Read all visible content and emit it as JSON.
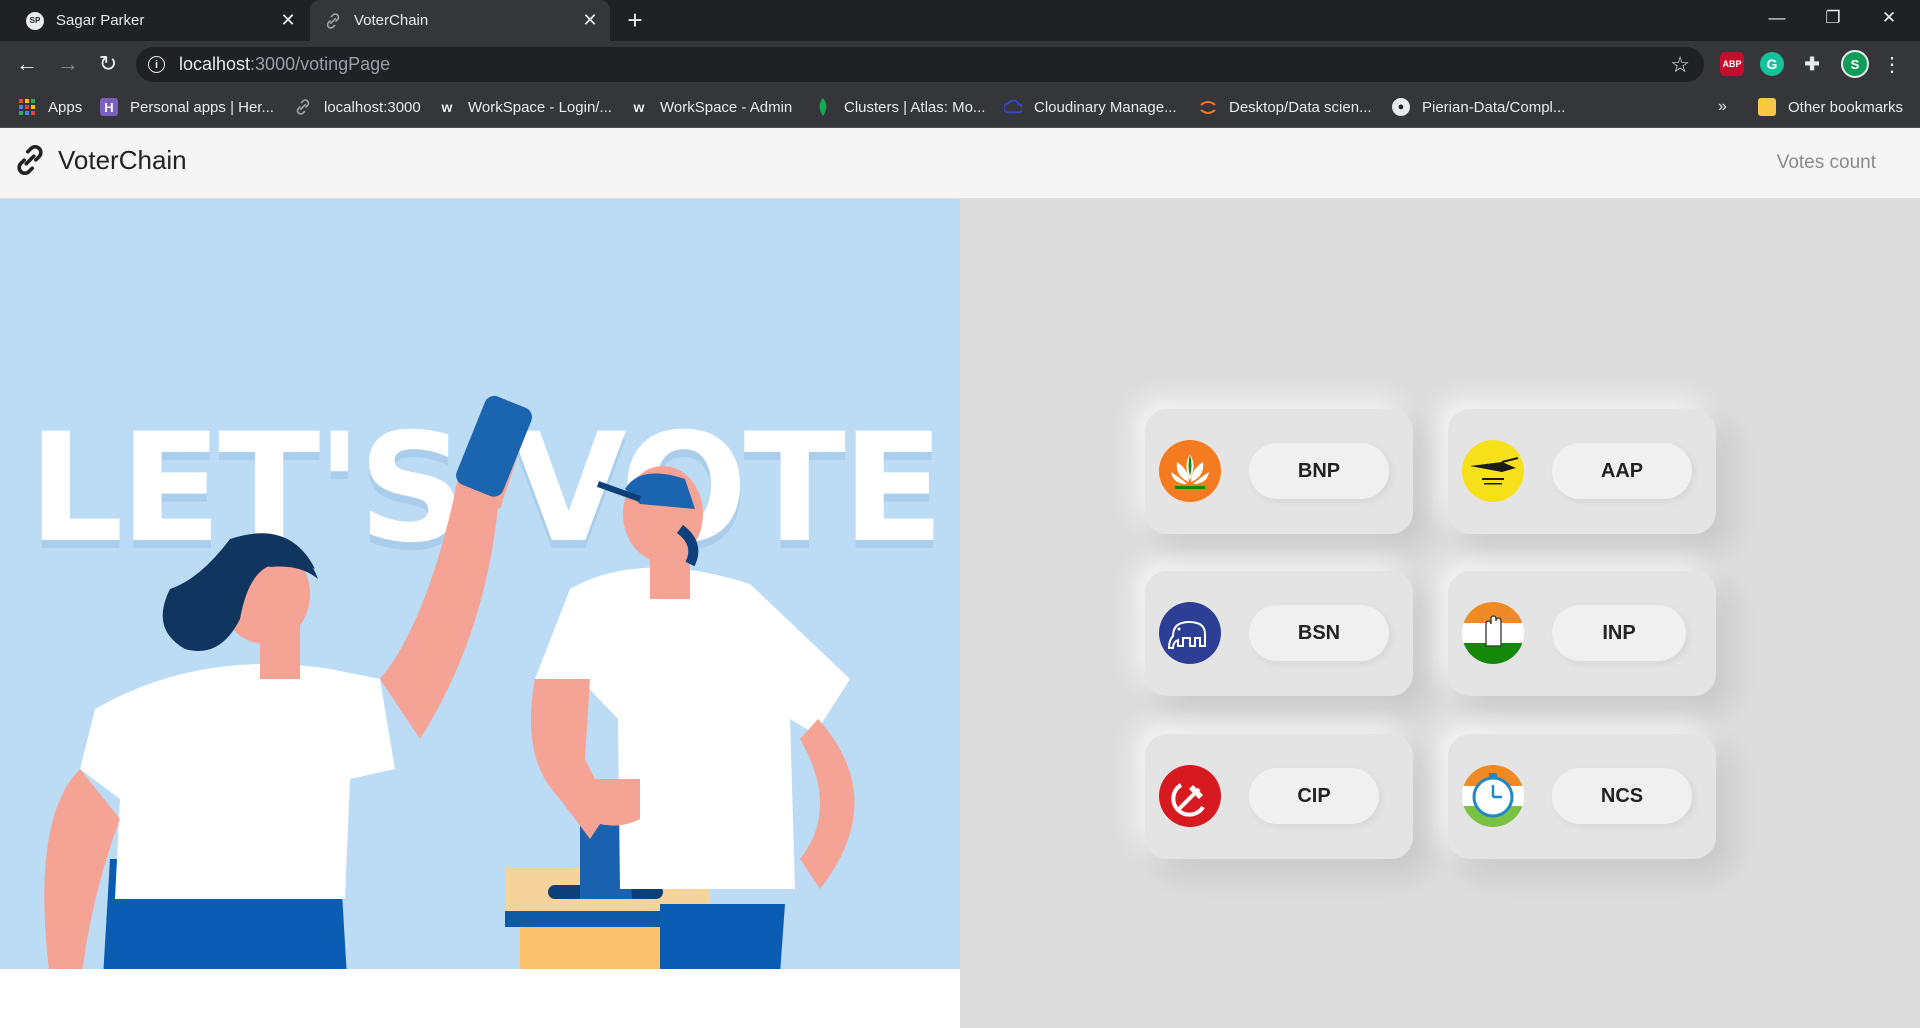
{
  "browser": {
    "tabs": [
      {
        "title": "Sagar Parker",
        "icon": "sp-favicon",
        "active": false
      },
      {
        "title": "VoterChain",
        "icon": "link-icon",
        "active": true
      }
    ],
    "address": {
      "host": "localhost",
      "path": ":3000/votingPage"
    },
    "extensions": [
      {
        "name": "adblock-plus",
        "label": "ABP",
        "color": "#c70d2c"
      },
      {
        "name": "grammarly",
        "label": "G",
        "color": "#15c39a"
      },
      {
        "name": "extensions-puzzle",
        "label": ""
      },
      {
        "name": "profile-avatar",
        "label": "S",
        "color": "#0f9d58"
      }
    ],
    "bookmarks": [
      {
        "label": "Apps",
        "icon": "apps-grid-icon"
      },
      {
        "label": "Personal apps | Her...",
        "icon": "heroku-icon"
      },
      {
        "label": "localhost:3000",
        "icon": "link-icon"
      },
      {
        "label": "WorkSpace - Login/...",
        "icon": "workspace-icon"
      },
      {
        "label": "WorkSpace - Admin",
        "icon": "workspace-icon"
      },
      {
        "label": "Clusters | Atlas: Mo...",
        "icon": "mongodb-leaf-icon"
      },
      {
        "label": "Cloudinary Manage...",
        "icon": "cloudinary-icon"
      },
      {
        "label": "Desktop/Data scien...",
        "icon": "jupyter-icon"
      },
      {
        "label": "Pierian-Data/Compl...",
        "icon": "github-icon"
      }
    ],
    "overflow": "»",
    "other_bookmarks": "Other bookmarks"
  },
  "app": {
    "brand": "VoterChain",
    "nav_link": "Votes count",
    "hero_text": "LET'S VOTE"
  },
  "parties": [
    {
      "name": "BNP",
      "logo": "lotus-logo-icon",
      "color": "#f47b20"
    },
    {
      "name": "AAP",
      "logo": "broom-logo-icon",
      "color": "#f6e01a"
    },
    {
      "name": "BSN",
      "logo": "elephant-logo-icon",
      "color": "#2c3f94"
    },
    {
      "name": "INP",
      "logo": "hand-logo-icon",
      "color": "#f08a24"
    },
    {
      "name": "CIP",
      "logo": "hammer-sickle-logo-icon",
      "color": "#d71920"
    },
    {
      "name": "NCS",
      "logo": "clock-logo-icon",
      "color": "#1e88c8"
    }
  ]
}
